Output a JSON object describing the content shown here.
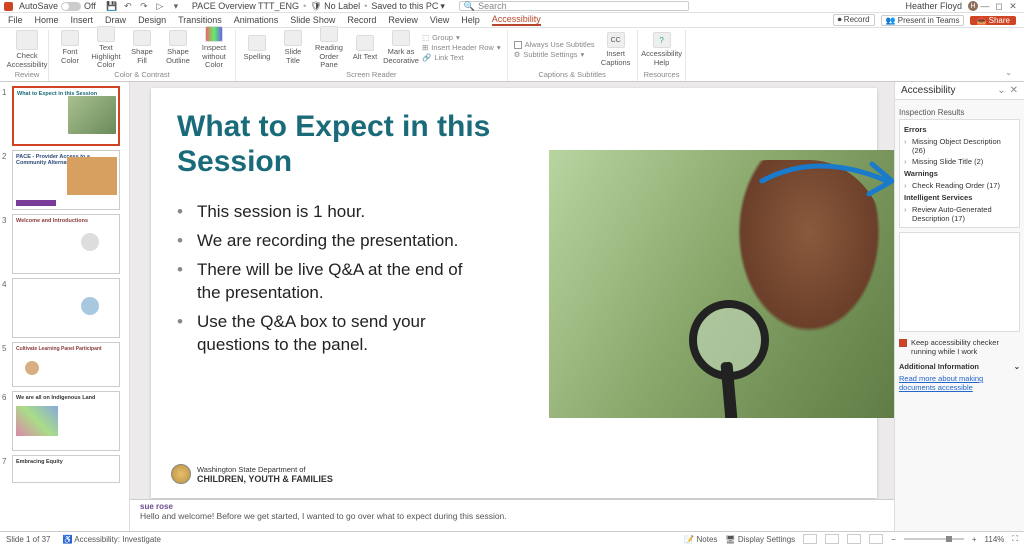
{
  "titlebar": {
    "autosave_label": "AutoSave",
    "autosave_state": "Off",
    "doc_name": "PACE Overview TTT_ENG",
    "sensitivity": "No Label",
    "saved_state": "Saved to this PC",
    "search_placeholder": "Search",
    "user_name": "Heather Floyd",
    "user_initial": "H"
  },
  "tabs": {
    "items": [
      "File",
      "Home",
      "Insert",
      "Draw",
      "Design",
      "Transitions",
      "Animations",
      "Slide Show",
      "Record",
      "Review",
      "View",
      "Help",
      "Accessibility"
    ],
    "active_index": 12,
    "record_btn": "Record",
    "present_btn": "Present in Teams",
    "share_btn": "Share"
  },
  "ribbon": {
    "check_acc": "Check\nAccessibility",
    "font_color": "Font\nColor",
    "text_hl": "Text Highlight\nColor",
    "shape_fill": "Shape\nFill",
    "shape_outline": "Shape\nOutline",
    "inspect_wc": "Inspect\nwithout Color",
    "spelling": "Spelling",
    "slide_title": "Slide\nTitle",
    "reading_order": "Reading\nOrder Pane",
    "alt_text": "Alt\nText",
    "mark_dec": "Mark as\nDecorative",
    "group": "Group",
    "insert_hdr": "Insert Header Row",
    "link_text": "Link Text",
    "always_subs": "Always Use Subtitles",
    "sub_settings": "Subtitle Settings",
    "insert_caps": "Insert\nCaptions",
    "acc_help": "Accessibility\nHelp",
    "grp_review": "Review",
    "grp_color": "Color & Contrast",
    "grp_reader": "Screen Reader",
    "grp_captions": "Captions & Subtitles",
    "grp_resources": "Resources"
  },
  "thumbnails": {
    "count": 7,
    "selected": 1,
    "titles": [
      "What to Expect in this Session",
      "PACE - Provider Access to a Community Alternative",
      "Welcome and Introductions",
      "",
      "Cultivate Learning Panel Participant",
      "We are all on Indigenous Land",
      "Embracing Equity"
    ]
  },
  "slide": {
    "title": "What to Expect in this Session",
    "bullets": [
      "This session is 1 hour.",
      "We are recording the presentation.",
      "There will be live Q&A at the end of the presentation.",
      "Use the Q&A box to send your questions to the panel."
    ],
    "footer_line1": "Washington State Department of",
    "footer_line2": "CHILDREN, YOUTH & FAMILIES"
  },
  "notes": {
    "author": "sue rose",
    "text": "Hello and  welcome!  Before we get started, I wanted to go over what to expect during this session."
  },
  "acc_pane": {
    "title": "Accessibility",
    "results_label": "Inspection Results",
    "errors_label": "Errors",
    "err1": "Missing Object Description (26)",
    "err2": "Missing Slide Title (2)",
    "warnings_label": "Warnings",
    "warn1": "Check Reading Order (17)",
    "intel_label": "Intelligent Services",
    "intel1": "Review Auto-Generated Description (17)",
    "keep_running": "Keep accessibility checker running while I work",
    "add_info": "Additional Information",
    "link": "Read more about making documents accessible"
  },
  "status": {
    "slide_pos": "Slide 1 of 37",
    "acc_status": "Accessibility: Investigate",
    "notes_btn": "Notes",
    "display_btn": "Display Settings",
    "zoom": "114%"
  }
}
